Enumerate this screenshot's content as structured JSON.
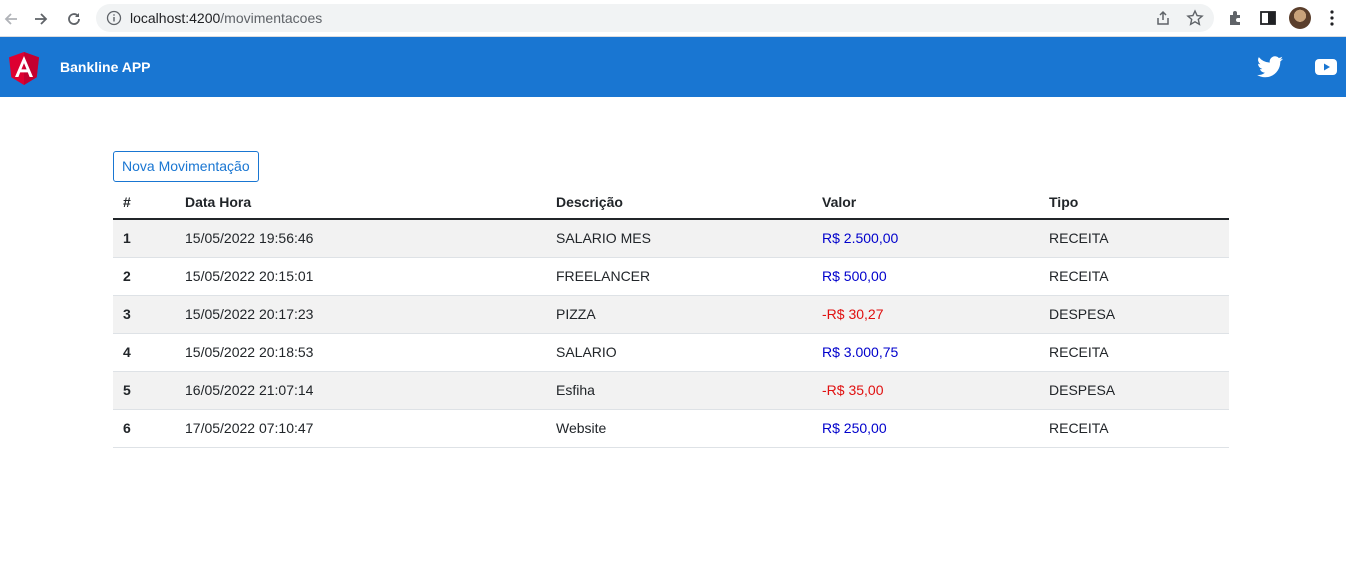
{
  "browser": {
    "url_host": "localhost:4200",
    "url_path": "/movimentacoes"
  },
  "navbar": {
    "title": "Bankline APP",
    "brand_color": "#1976d2"
  },
  "actions": {
    "new_button_label": "Nova Movimentação"
  },
  "table": {
    "headers": [
      "#",
      "Data Hora",
      "Descrição",
      "Valor",
      "Tipo"
    ],
    "rows": [
      {
        "index": "1",
        "datetime": "15/05/2022 19:56:46",
        "description": "SALARIO MES",
        "value": "R$ 2.500,00",
        "type": "RECEITA"
      },
      {
        "index": "2",
        "datetime": "15/05/2022 20:15:01",
        "description": "FREELANCER",
        "value": "R$ 500,00",
        "type": "RECEITA"
      },
      {
        "index": "3",
        "datetime": "15/05/2022 20:17:23",
        "description": "PIZZA",
        "value": "-R$ 30,27",
        "type": "DESPESA"
      },
      {
        "index": "4",
        "datetime": "15/05/2022 20:18:53",
        "description": "SALARIO",
        "value": "R$ 3.000,75",
        "type": "RECEITA"
      },
      {
        "index": "5",
        "datetime": "16/05/2022 21:07:14",
        "description": "Esfiha",
        "value": "-R$ 35,00",
        "type": "DESPESA"
      },
      {
        "index": "6",
        "datetime": "17/05/2022 07:10:47",
        "description": "Website",
        "value": "R$ 250,00",
        "type": "RECEITA"
      }
    ]
  }
}
